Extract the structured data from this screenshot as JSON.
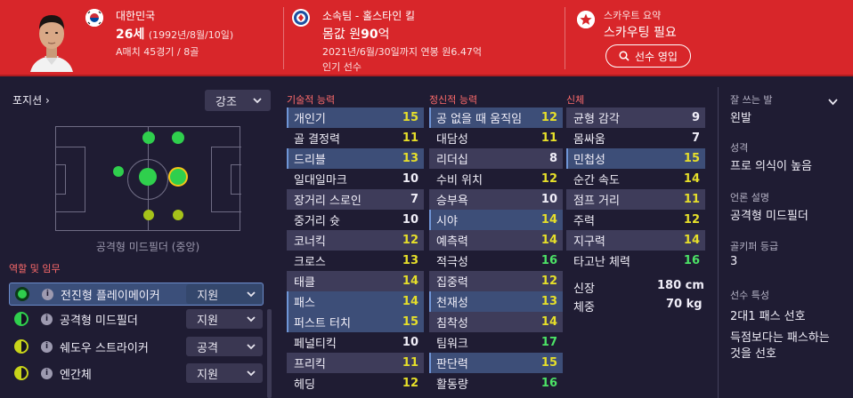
{
  "header": {
    "nation": "대한민국",
    "age": "26세",
    "birth": "(1992년/8월/10일)",
    "caps": "A매치 45경기 / 8골",
    "club": "소속팀 - 홀스타인 킬",
    "value_prefix": "몸값 원",
    "value_num": "90",
    "value_suffix": "억",
    "contract": "2021년/6월/30일까지 연봉 원6.47억",
    "popularity": "인기 선수",
    "scout_label": "스카우트 요약",
    "scout_value": "스카우팅 필요",
    "scout_button": "선수 영입",
    "colors": {
      "header_bg": "#d8262a"
    }
  },
  "left": {
    "positions_label": "포지션",
    "emphasis_select": "강조",
    "pitch_caption": "공격형 미드필더 (중앙)",
    "roles_title": "역할 및 임무",
    "roles": [
      {
        "name": "전진형 플레이메이커",
        "duty": "지원",
        "rating": "full"
      },
      {
        "name": "공격형 미드필더",
        "duty": "지원",
        "rating": "half"
      },
      {
        "name": "쉐도우 스트라이커",
        "duty": "공격",
        "rating": "half"
      },
      {
        "name": "엔간체",
        "duty": "지원",
        "rating": "half"
      }
    ]
  },
  "technical": {
    "title": "기술적 능력",
    "attrs": [
      {
        "name": "개인기",
        "value": "15",
        "tone": "yellow",
        "key": true
      },
      {
        "name": "골 결정력",
        "value": "11",
        "tone": "yellow"
      },
      {
        "name": "드리블",
        "value": "13",
        "tone": "yellow",
        "key": true
      },
      {
        "name": "일대일마크",
        "value": "10",
        "tone": "white"
      },
      {
        "name": "장거리 스로인",
        "value": "7",
        "tone": "white"
      },
      {
        "name": "중거리 슛",
        "value": "10",
        "tone": "white"
      },
      {
        "name": "코너킥",
        "value": "12",
        "tone": "yellow"
      },
      {
        "name": "크로스",
        "value": "13",
        "tone": "yellow"
      },
      {
        "name": "태클",
        "value": "14",
        "tone": "yellow"
      },
      {
        "name": "패스",
        "value": "14",
        "tone": "yellow",
        "key": true
      },
      {
        "name": "퍼스트 터치",
        "value": "15",
        "tone": "yellow",
        "key": true
      },
      {
        "name": "페널티킥",
        "value": "10",
        "tone": "white"
      },
      {
        "name": "프리킥",
        "value": "11",
        "tone": "yellow"
      },
      {
        "name": "헤딩",
        "value": "12",
        "tone": "yellow"
      }
    ]
  },
  "mental": {
    "title": "정신적 능력",
    "attrs": [
      {
        "name": "공 없을 때 움직임",
        "value": "12",
        "tone": "yellow",
        "key": true
      },
      {
        "name": "대담성",
        "value": "11",
        "tone": "yellow"
      },
      {
        "name": "리더십",
        "value": "8",
        "tone": "white"
      },
      {
        "name": "수비 위치",
        "value": "12",
        "tone": "yellow"
      },
      {
        "name": "승부욕",
        "value": "10",
        "tone": "white"
      },
      {
        "name": "시야",
        "value": "14",
        "tone": "yellow",
        "key": true
      },
      {
        "name": "예측력",
        "value": "14",
        "tone": "yellow"
      },
      {
        "name": "적극성",
        "value": "16",
        "tone": "green"
      },
      {
        "name": "집중력",
        "value": "12",
        "tone": "yellow"
      },
      {
        "name": "천재성",
        "value": "13",
        "tone": "yellow",
        "key": true
      },
      {
        "name": "침착성",
        "value": "14",
        "tone": "yellow"
      },
      {
        "name": "팀워크",
        "value": "17",
        "tone": "green"
      },
      {
        "name": "판단력",
        "value": "15",
        "tone": "yellow",
        "key": true
      },
      {
        "name": "활동량",
        "value": "16",
        "tone": "green"
      }
    ]
  },
  "physical": {
    "title": "신체",
    "attrs": [
      {
        "name": "균형 감각",
        "value": "9",
        "tone": "white"
      },
      {
        "name": "몸싸움",
        "value": "7",
        "tone": "white"
      },
      {
        "name": "민첩성",
        "value": "15",
        "tone": "yellow",
        "key": true
      },
      {
        "name": "순간 속도",
        "value": "14",
        "tone": "yellow"
      },
      {
        "name": "점프 거리",
        "value": "11",
        "tone": "yellow"
      },
      {
        "name": "주력",
        "value": "12",
        "tone": "yellow"
      },
      {
        "name": "지구력",
        "value": "14",
        "tone": "yellow"
      },
      {
        "name": "타고난 체력",
        "value": "16",
        "tone": "green"
      }
    ],
    "height_label": "신장",
    "height_value": "180 cm",
    "weight_label": "체중",
    "weight_value": "70 kg"
  },
  "right": {
    "foot_label": "잘 쓰는 발",
    "foot_value": "왼발",
    "personality_label": "성격",
    "personality_value": "프로 의식이 높음",
    "media_label": "언론 설명",
    "media_value": "공격형 미드필더",
    "gk_label": "골키퍼 등급",
    "gk_value": "3",
    "traits_label": "선수 특성",
    "traits": [
      "2대1 패스 선호",
      "득점보다는 패스하는",
      "것을 선호"
    ]
  },
  "icons": {
    "flag": "korea-flag-icon",
    "club": "holstein-kiel-crest-icon",
    "scout": "star-badge-icon",
    "search": "search-icon"
  },
  "colors": {
    "page_bg": "#1f1c33",
    "accent_red": "#d8262a",
    "attr_green": "#4ce266",
    "attr_yellow": "#e6df2a",
    "key_highlight": "#3d4e78"
  }
}
